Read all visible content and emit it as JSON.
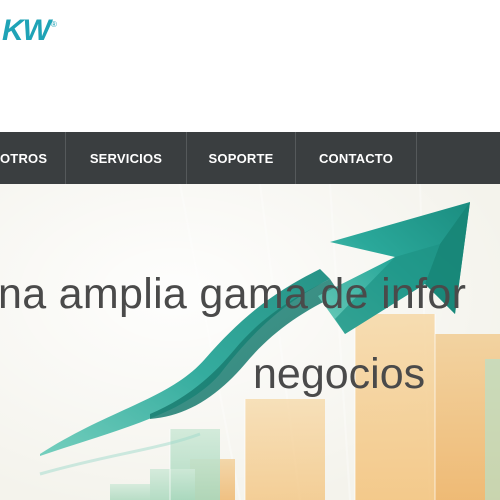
{
  "logo": {
    "text": "KW",
    "registered_mark": "®",
    "color": "#1fa3b6"
  },
  "nav": {
    "items": [
      {
        "label": "OTROS"
      },
      {
        "label": "SERVICIOS"
      },
      {
        "label": "SOPORTE"
      },
      {
        "label": "CONTACTO"
      }
    ],
    "background": "#3a3e40"
  },
  "hero": {
    "line1": "na amplia gama de infor",
    "line2": "negocios",
    "text_color": "#4a4a4a",
    "arrow_color": "#2aa89a"
  }
}
